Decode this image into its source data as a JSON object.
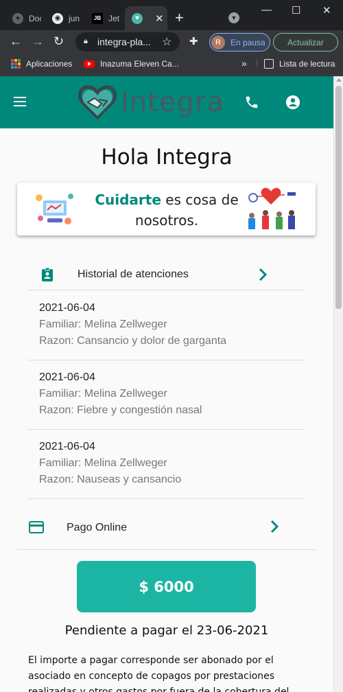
{
  "browser": {
    "tabs": [
      {
        "title": "Doc"
      },
      {
        "title": "jun"
      },
      {
        "title": "Jet"
      },
      {
        "title": ""
      }
    ],
    "url": "integra-pla...",
    "profile_label": "En pausa",
    "profile_initial": "R",
    "update_label": "Actualizar",
    "bookmarks": {
      "apps": "Aplicaciones",
      "youtube": "Inazuma Eleven Ca...",
      "more": "»",
      "reading_list": "Lista de lectura"
    }
  },
  "app": {
    "brand": "Integra",
    "greeting": "Hola Integra",
    "banner": {
      "highlight": "Cuidarte",
      "rest": " es cosa de nosotros."
    },
    "history": {
      "title": "Historial de atenciones",
      "items": [
        {
          "date": "2021-06-04",
          "family": "Familiar: Melina Zellweger",
          "reason": "Razon: Cansancio y dolor de garganta"
        },
        {
          "date": "2021-06-04",
          "family": "Familiar: Melina Zellweger",
          "reason": "Razon: Fiebre y congestión nasal"
        },
        {
          "date": "2021-06-04",
          "family": "Familiar: Melina Zellweger",
          "reason": "Razon: Nauseas y cansancio"
        }
      ]
    },
    "payment": {
      "title": "Pago Online",
      "amount": "$ 6000",
      "due": "Pendiente a pagar el 23-06-2021",
      "disclaimer": "El importe a pagar corresponde ser abonado por el asociado en concepto de copagos por prestaciones realizadas y otros gastos por fuera de la cobertura del"
    },
    "colors": {
      "primary": "#00897b",
      "accent_button": "#1cb5a3"
    }
  }
}
